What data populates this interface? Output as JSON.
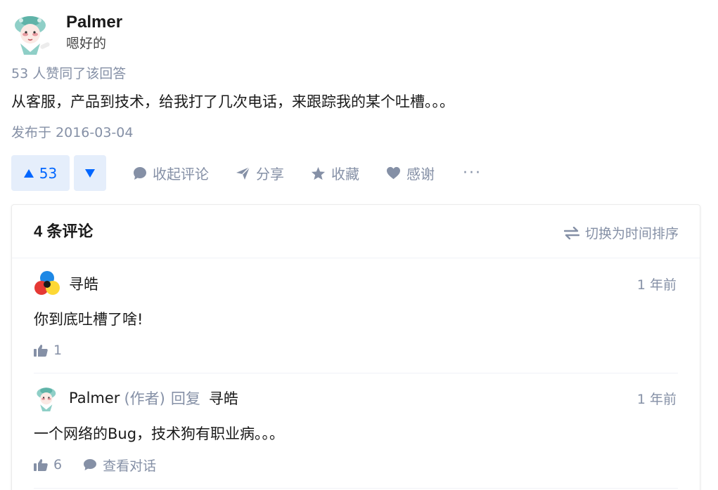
{
  "answer": {
    "author": {
      "name": "Palmer",
      "bio": "嗯好的",
      "avatar_icon": "opera-mask-avatar-icon"
    },
    "voters_text": "53 人赞同了该回答",
    "content": "从客服，产品到技术，给我打了几次电话，来跟踪我的某个吐槽。。。",
    "published": "发布于 2016-03-04"
  },
  "actions": {
    "upvote_count": "53",
    "collapse_comments": "收起评论",
    "share": "分享",
    "collect": "收藏",
    "thanks": "感谢",
    "more": "···"
  },
  "comments": {
    "count_label": "4 条评论",
    "sort_label": "切换为时间排序",
    "items": [
      {
        "author": "寻皓",
        "time": "1 年前",
        "text": "你到底吐槽了啥!",
        "likes": "1"
      },
      {
        "author": "Palmer",
        "role": "(作者)",
        "reply_word": "回复",
        "reply_to": "寻皓",
        "time": "1 年前",
        "text": "一个网络的Bug，技术狗有职业病。。。",
        "likes": "6",
        "view_dialog": "查看对话"
      }
    ]
  },
  "colors": {
    "accent": "#0066ff",
    "accent_bg": "#e5eefb",
    "muted": "#8590a6",
    "text": "#1a1a1a"
  }
}
